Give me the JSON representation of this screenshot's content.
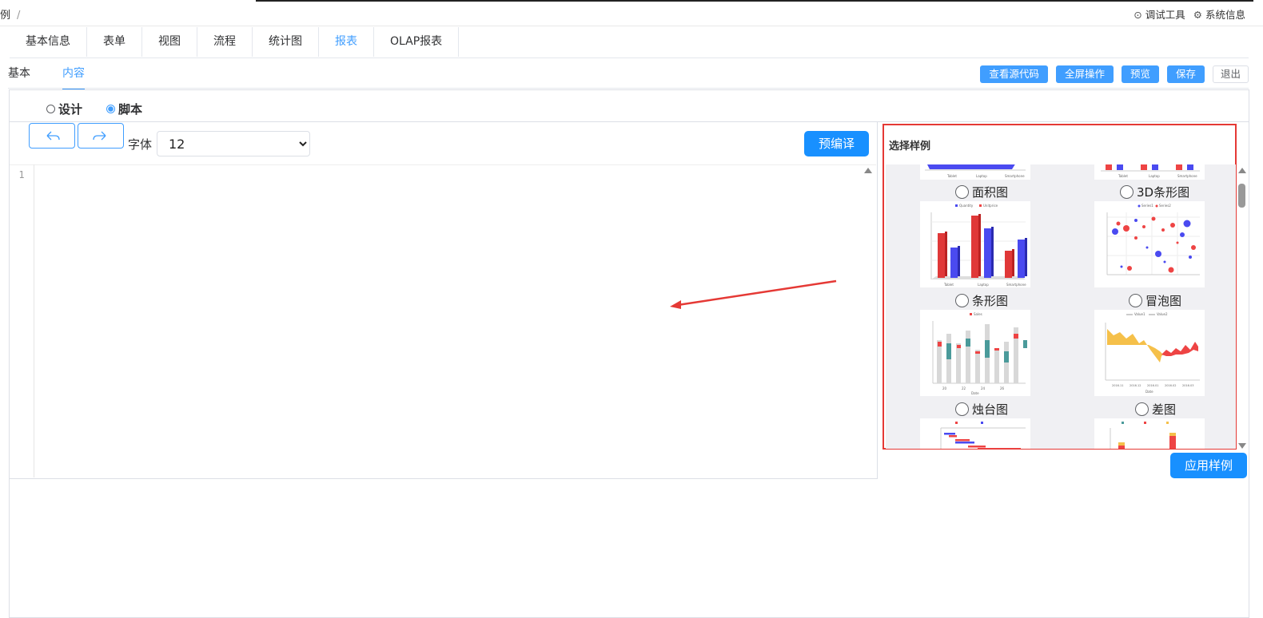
{
  "breadcrumb": {
    "item": "示例",
    "separator": "/"
  },
  "top_tools": [
    {
      "icon": "debug-icon",
      "label": "调试工具"
    },
    {
      "icon": "gear-icon",
      "label": "系统信息"
    }
  ],
  "main_tabs": [
    {
      "label": "基本信息",
      "active": false
    },
    {
      "label": "表单",
      "active": false
    },
    {
      "label": "视图",
      "active": false
    },
    {
      "label": "流程",
      "active": false
    },
    {
      "label": "统计图",
      "active": false
    },
    {
      "label": "报表",
      "active": true
    },
    {
      "label": "OLAP报表",
      "active": false
    }
  ],
  "sub_tabs": [
    {
      "label": "基本",
      "active": false
    },
    {
      "label": "内容",
      "active": true
    }
  ],
  "actions": {
    "view_source": "查看源代码",
    "fullscreen": "全屏操作",
    "preview": "预览",
    "save": "保存",
    "exit": "退出"
  },
  "mode": {
    "design_label": "设计",
    "script_label": "脚本",
    "selected": "script"
  },
  "editor": {
    "font_label": "字体",
    "font_size": "12",
    "font_options": [
      "12"
    ],
    "precompile_label": "预编译",
    "line_number": "1",
    "content": ""
  },
  "samples": {
    "title": "选择样例",
    "items": [
      {
        "label": "面积图"
      },
      {
        "label": "3D条形图"
      },
      {
        "label": "条形图"
      },
      {
        "label": "冒泡图"
      },
      {
        "label": "烛台图"
      },
      {
        "label": "差图"
      }
    ],
    "apply_label": "应用样例"
  },
  "colors": {
    "accent": "#409eff",
    "primary_button": "#1890ff",
    "highlight_box": "#e53935",
    "annotation_arrow": "#e53935"
  }
}
